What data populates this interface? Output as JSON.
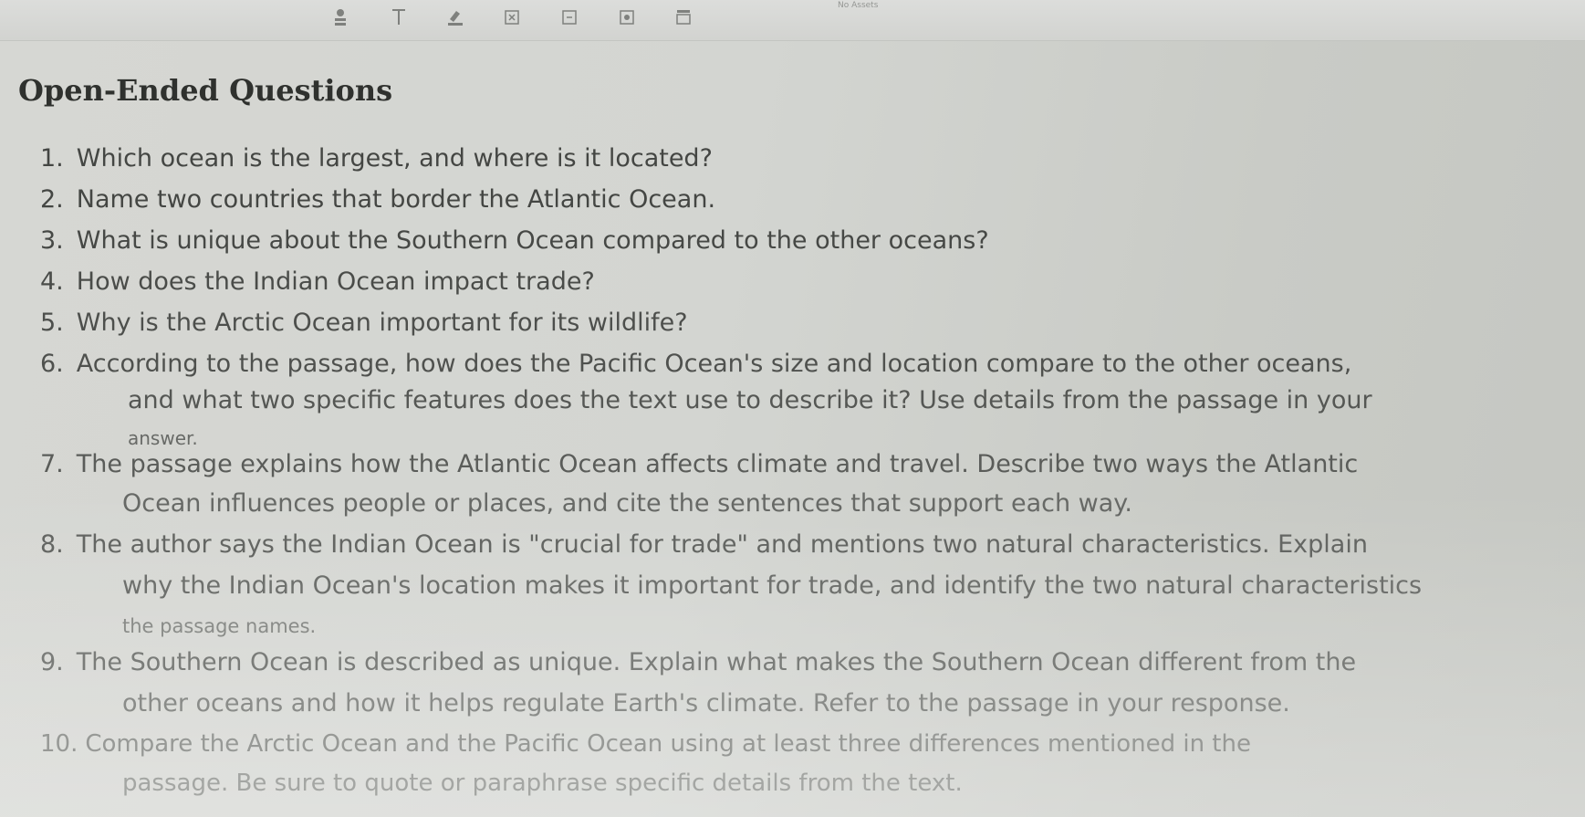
{
  "toolbar": {
    "icons": [
      "person-icon",
      "text-icon",
      "highlight-icon",
      "close-box-icon",
      "minus-box-icon",
      "record-box-icon",
      "flag-icon"
    ],
    "zoom_text": "No Assets"
  },
  "title": "Open-Ended Questions",
  "questions": [
    {
      "number": "1.",
      "lines": [
        "Which ocean is the largest, and where is it located?"
      ]
    },
    {
      "number": "2.",
      "lines": [
        "Name two countries that border the Atlantic Ocean."
      ]
    },
    {
      "number": "3.",
      "lines": [
        "What is unique about the Southern Ocean compared to the other oceans?"
      ]
    },
    {
      "number": "4.",
      "lines": [
        "How does the Indian Ocean impact trade?"
      ]
    },
    {
      "number": "5.",
      "lines": [
        "Why is the Arctic Ocean important for its wildlife?"
      ]
    },
    {
      "number": "6.",
      "lines": [
        "According to the passage, how does the Pacific Ocean's size and location compare to the other oceans,",
        "and what two specific features does the text use to describe it? Use details from the passage in your",
        "answer."
      ]
    },
    {
      "number": "7.",
      "lines": [
        "The passage explains how the Atlantic Ocean affects climate and travel. Describe two ways the Atlantic",
        "Ocean influences people or places, and cite the sentences that support each way."
      ]
    },
    {
      "number": "8.",
      "lines": [
        "The author says the Indian Ocean is \"crucial for trade\" and mentions two natural characteristics. Explain",
        "why the Indian Ocean's location makes it important for trade, and identify the two natural characteristics",
        "the passage names."
      ]
    },
    {
      "number": "9.",
      "lines": [
        "The Southern Ocean is described as unique. Explain what makes the Southern Ocean different from the",
        "other oceans and how it helps regulate Earth's climate. Refer to the passage in your response."
      ]
    },
    {
      "number": "10.",
      "lines": [
        "Compare the Arctic Ocean and the Pacific Ocean using at least three differences mentioned in the",
        "passage. Be sure to quote or paraphrase specific details from the text."
      ]
    }
  ]
}
